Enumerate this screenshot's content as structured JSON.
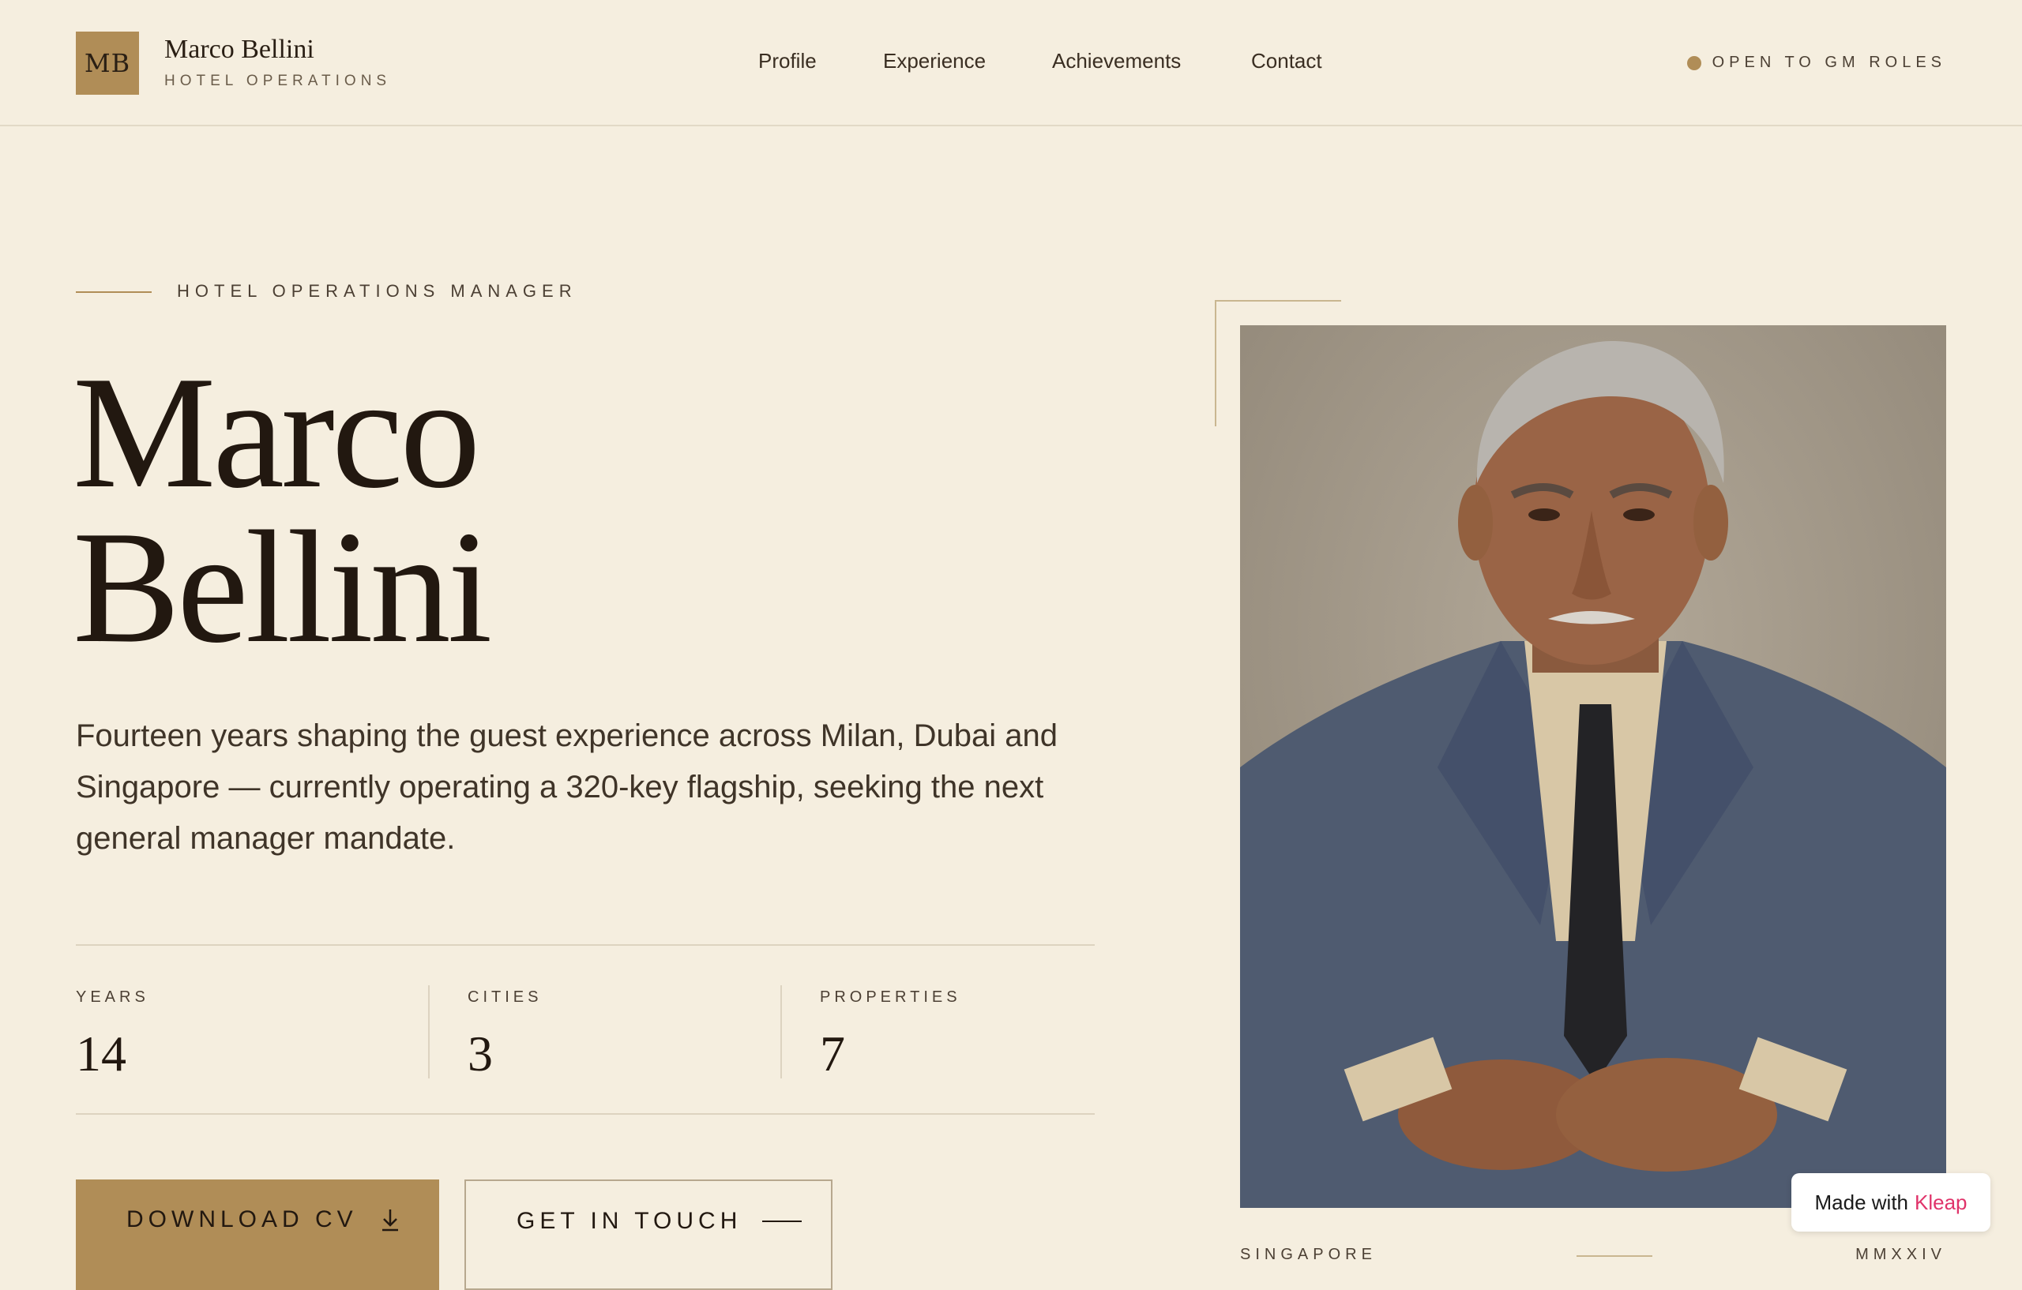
{
  "header": {
    "monogram": "MB",
    "name": "Marco Bellini",
    "subtitle": "HOTEL OPERATIONS",
    "nav": [
      {
        "label": "Profile"
      },
      {
        "label": "Experience"
      },
      {
        "label": "Achievements"
      },
      {
        "label": "Contact"
      }
    ],
    "status": "OPEN TO GM ROLES"
  },
  "hero": {
    "eyebrow": "HOTEL OPERATIONS MANAGER",
    "first_name": "Marco",
    "last_name": "Bellini",
    "intro": "Fourteen years shaping the guest experience across Milan, Dubai and Singapore — currently operating a 320-key flagship, seeking the next general manager mandate.",
    "stats": [
      {
        "label": "YEARS",
        "value": "14"
      },
      {
        "label": "CITIES",
        "value": "3"
      },
      {
        "label": "PROPERTIES",
        "value": "7"
      }
    ],
    "primary_button": "DOWNLOAD CV",
    "primary_icon": "download-icon",
    "secondary_button": "GET IN TOUCH",
    "secondary_icon": "arrow-line-icon"
  },
  "portrait": {
    "caption_left": "SINGAPORE",
    "caption_right": "MMXXIV"
  },
  "badge": {
    "prefix": "Made with",
    "brand": "Kleap"
  },
  "colors": {
    "background": "#f5eedf",
    "accent": "#b08d57",
    "text": "#221810",
    "badge_brand": "#e0336a"
  }
}
